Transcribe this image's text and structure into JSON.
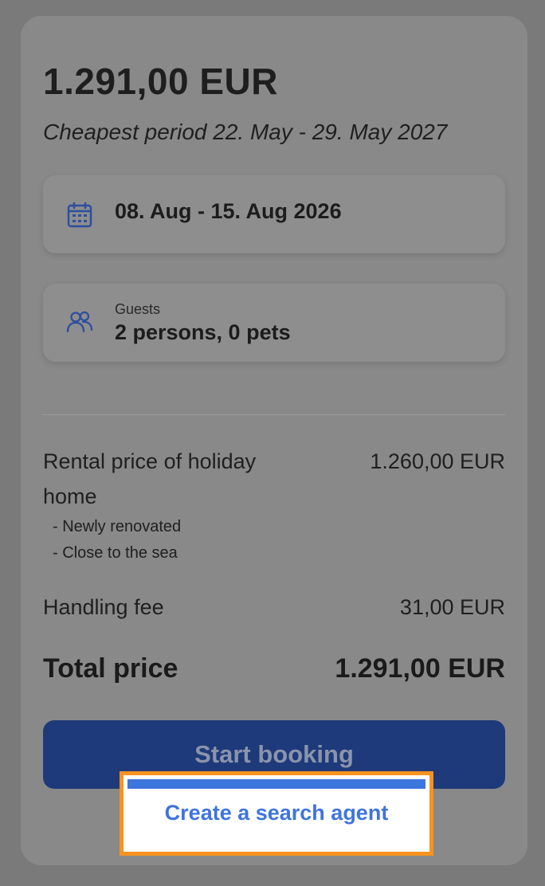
{
  "price": {
    "amount": "1.291,00 EUR",
    "cheapest_period": "Cheapest period 22. May - 29. May 2027"
  },
  "dates": {
    "icon": "calendar-icon",
    "value": "08. Aug - 15. Aug 2026"
  },
  "guests": {
    "icon": "people-icon",
    "label": "Guests",
    "value": "2 persons, 0 pets"
  },
  "breakdown": {
    "rental_label": "Rental price of holiday home",
    "rental_value": "1.260,00 EUR",
    "bullets": [
      "- Newly renovated",
      "- Close to the sea"
    ],
    "fee_label": "Handling fee",
    "fee_value": "31,00 EUR",
    "total_label": "Total price",
    "total_value": "1.291,00 EUR"
  },
  "actions": {
    "start_booking": "Start booking",
    "search_agent": "Create a search agent"
  },
  "colors": {
    "primary_button": "#1e3a7a",
    "link": "#3e74de",
    "highlight": "#f7931e",
    "icon": "#2c4f9e"
  }
}
